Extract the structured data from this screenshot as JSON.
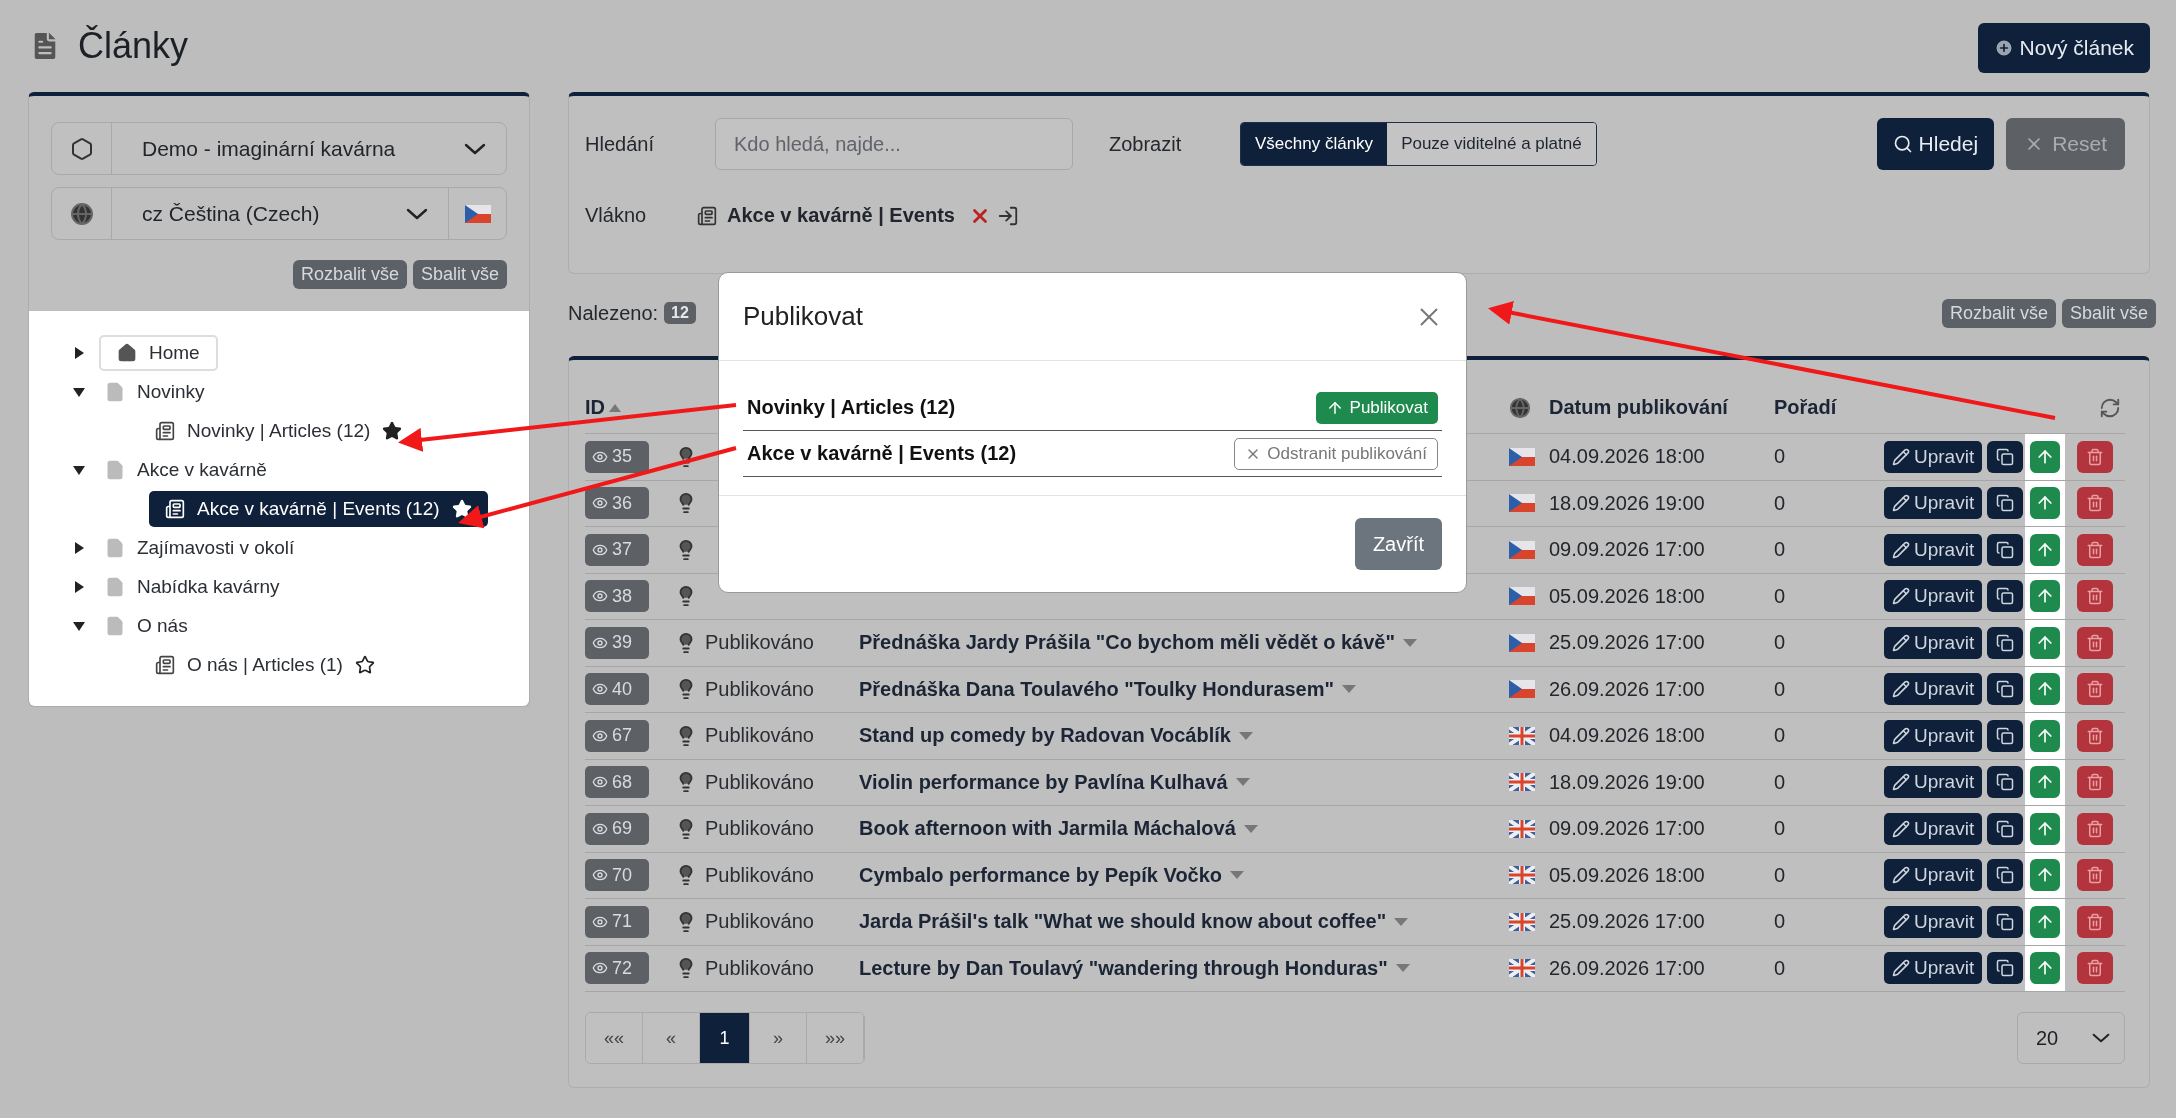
{
  "header": {
    "title": "Články",
    "new_button": "Nový článek"
  },
  "sidebar": {
    "project": "Demo - imaginární kavárna",
    "language": "cz Čeština (Czech)",
    "expand_all": "Rozbalit vše",
    "collapse_all": "Sbalit vše",
    "tree": [
      {
        "label": "Home",
        "kind": "home",
        "expanded": false
      },
      {
        "label": "Novinky",
        "kind": "page",
        "expanded": true,
        "children": [
          {
            "label": "Novinky | Articles (12)",
            "kind": "thread",
            "selected": false,
            "starred": true
          }
        ]
      },
      {
        "label": "Akce v kavárně",
        "kind": "page",
        "expanded": true,
        "children": [
          {
            "label": "Akce v kavárně | Events (12)",
            "kind": "thread",
            "selected": true,
            "starred": true
          }
        ]
      },
      {
        "label": "Zajímavosti v okolí",
        "kind": "page",
        "expanded": false
      },
      {
        "label": "Nabídka kavárny",
        "kind": "page",
        "expanded": false
      },
      {
        "label": "O nás",
        "kind": "page",
        "expanded": true,
        "children": [
          {
            "label": "O nás | Articles (1)",
            "kind": "thread",
            "selected": false,
            "starred": false
          }
        ]
      }
    ]
  },
  "filter": {
    "search_label": "Hledání",
    "search_placeholder": "Kdo hledá, najde...",
    "show_label": "Zobrazit",
    "show_options": [
      {
        "label": "Všechny články",
        "selected": true
      },
      {
        "label": "Pouze viditelné a platné",
        "selected": false
      }
    ],
    "search_button": "Hledej",
    "reset_button": "Reset",
    "thread_label": "Vlákno",
    "thread_value": "Akce v kavárně | Events"
  },
  "results": {
    "found_label": "Nalezeno:",
    "count": "12",
    "expand_all": "Rozbalit vše",
    "collapse_all": "Sbalit vše"
  },
  "table": {
    "columns": {
      "id": "ID",
      "date": "Datum publikování",
      "order": "Pořadí"
    },
    "rows": [
      {
        "id": "35",
        "kind": "cz",
        "date": "04.09.2026 18:00",
        "order": "0",
        "edit": "Upravit"
      },
      {
        "id": "36",
        "kind": "cz",
        "date": "18.09.2026 19:00",
        "order": "0",
        "edit": "Upravit"
      },
      {
        "id": "37",
        "kind": "cz",
        "date": "09.09.2026 17:00",
        "order": "0",
        "edit": "Upravit"
      },
      {
        "id": "38",
        "kind": "cz",
        "date": "05.09.2026 18:00",
        "order": "0",
        "edit": "Upravit"
      },
      {
        "id": "39",
        "status": "Publikováno",
        "title": "Přednáška Jardy Prášila \"Co bychom měli vědět o kávě\"",
        "kind": "cz",
        "date": "25.09.2026 17:00",
        "order": "0",
        "edit": "Upravit"
      },
      {
        "id": "40",
        "status": "Publikováno",
        "title": "Přednáška Dana Toulavého \"Toulky Hondurasem\"",
        "kind": "cz",
        "date": "26.09.2026 17:00",
        "order": "0",
        "edit": "Upravit"
      },
      {
        "id": "67",
        "status": "Publikováno",
        "title": "Stand up comedy by Radovan Vocáblík",
        "kind": "gb",
        "date": "04.09.2026 18:00",
        "order": "0",
        "edit": "Upravit"
      },
      {
        "id": "68",
        "status": "Publikováno",
        "title": "Violin performance by Pavlína Kulhavá",
        "kind": "gb",
        "date": "18.09.2026 19:00",
        "order": "0",
        "edit": "Upravit"
      },
      {
        "id": "69",
        "status": "Publikováno",
        "title": "Book afternoon with Jarmila Máchalová",
        "kind": "gb",
        "date": "09.09.2026 17:00",
        "order": "0",
        "edit": "Upravit"
      },
      {
        "id": "70",
        "status": "Publikováno",
        "title": "Cymbalo performance by Pepík Vočko",
        "kind": "gb",
        "date": "05.09.2026 18:00",
        "order": "0",
        "edit": "Upravit"
      },
      {
        "id": "71",
        "status": "Publikováno",
        "title": "Jarda Prášil's talk \"What we should know about coffee\"",
        "kind": "gb",
        "date": "25.09.2026 17:00",
        "order": "0",
        "edit": "Upravit"
      },
      {
        "id": "72",
        "status": "Publikováno",
        "title": "Lecture by Dan Toulavý \"wandering through Honduras\"",
        "kind": "gb",
        "date": "26.09.2026 17:00",
        "order": "0",
        "edit": "Upravit"
      }
    ]
  },
  "pagination": [
    {
      "label": "««",
      "selected": false
    },
    {
      "label": "«",
      "selected": false
    },
    {
      "label": "1",
      "selected": true
    },
    {
      "label": "»",
      "selected": false
    },
    {
      "label": "»»",
      "selected": false
    }
  ],
  "page_size": "20",
  "modal": {
    "title": "Publikovat",
    "rows": [
      {
        "label": "Novinky | Articles (12)",
        "published": false,
        "action": "Publikovat"
      },
      {
        "label": "Akce v kavárně | Events (12)",
        "published": true,
        "action": "Odstranit publikování"
      }
    ],
    "close_button": "Zavřít"
  }
}
